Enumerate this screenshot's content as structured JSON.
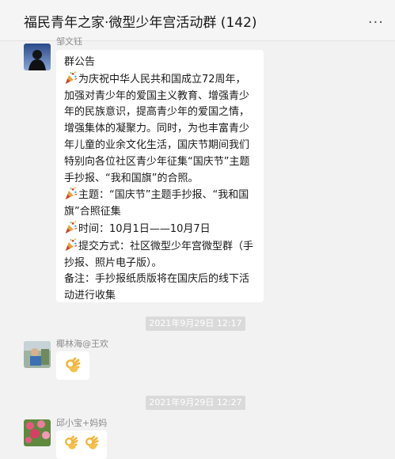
{
  "header": {
    "title": "福民青年之家·微型少年宫活动群 (142)",
    "more_label": "···",
    "top_icons": "· · ·"
  },
  "messages": [
    {
      "sender": "邹文钰",
      "type": "notice",
      "heading": "群公告",
      "para1": "为庆祝中华人民共和国成立72周年，加强对青少年的爱国主义教育、增强青少年的民族意识，提高青少年的爱国之情，增强集体的凝聚力。同时，为也丰富青少年儿童的业余文化生活，国庆节期间我们特别向各位社区青少年征集“国庆节”主题手抄报、“我和国旗”的合照。",
      "topic": "主题：“国庆节”主题手抄报、“我和国旗”合照征集",
      "time": "时间：10月1日——10月7日",
      "submit": "提交方式：社区微型少年宫微型群（手抄报、照片电子版）。",
      "note": "备注：手抄报纸质版将在国庆后的线下活动进行收集"
    },
    {
      "timestamp": "2021年9月29日 12:17",
      "sender": "椰林海@王欢",
      "type": "emoji",
      "emoji_icon": "ok-hand-icon"
    },
    {
      "timestamp": "2021年9月29日 12:27",
      "sender": "邱小宝+妈妈",
      "type": "emoji",
      "emoji_icon": "ok-hand-icon"
    }
  ],
  "colors": {
    "background": "#f2f2f2",
    "bubble": "#ffffff",
    "timestamp_bg": "#dadada",
    "sender_text": "#8b8b8b"
  }
}
